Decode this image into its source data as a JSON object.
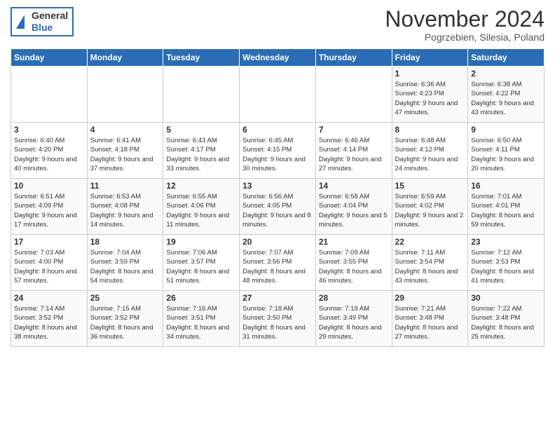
{
  "header": {
    "logo_general": "General",
    "logo_blue": "Blue",
    "month_title": "November 2024",
    "subtitle": "Pogrzebien, Silesia, Poland"
  },
  "weekdays": [
    "Sunday",
    "Monday",
    "Tuesday",
    "Wednesday",
    "Thursday",
    "Friday",
    "Saturday"
  ],
  "weeks": [
    [
      {
        "day": "",
        "info": ""
      },
      {
        "day": "",
        "info": ""
      },
      {
        "day": "",
        "info": ""
      },
      {
        "day": "",
        "info": ""
      },
      {
        "day": "",
        "info": ""
      },
      {
        "day": "1",
        "info": "Sunrise: 6:36 AM\nSunset: 4:23 PM\nDaylight: 9 hours and 47 minutes."
      },
      {
        "day": "2",
        "info": "Sunrise: 6:38 AM\nSunset: 4:22 PM\nDaylight: 9 hours and 43 minutes."
      }
    ],
    [
      {
        "day": "3",
        "info": "Sunrise: 6:40 AM\nSunset: 4:20 PM\nDaylight: 9 hours and 40 minutes."
      },
      {
        "day": "4",
        "info": "Sunrise: 6:41 AM\nSunset: 4:18 PM\nDaylight: 9 hours and 37 minutes."
      },
      {
        "day": "5",
        "info": "Sunrise: 6:43 AM\nSunset: 4:17 PM\nDaylight: 9 hours and 33 minutes."
      },
      {
        "day": "6",
        "info": "Sunrise: 6:45 AM\nSunset: 4:15 PM\nDaylight: 9 hours and 30 minutes."
      },
      {
        "day": "7",
        "info": "Sunrise: 6:46 AM\nSunset: 4:14 PM\nDaylight: 9 hours and 27 minutes."
      },
      {
        "day": "8",
        "info": "Sunrise: 6:48 AM\nSunset: 4:12 PM\nDaylight: 9 hours and 24 minutes."
      },
      {
        "day": "9",
        "info": "Sunrise: 6:50 AM\nSunset: 4:11 PM\nDaylight: 9 hours and 20 minutes."
      }
    ],
    [
      {
        "day": "10",
        "info": "Sunrise: 6:51 AM\nSunset: 4:09 PM\nDaylight: 9 hours and 17 minutes."
      },
      {
        "day": "11",
        "info": "Sunrise: 6:53 AM\nSunset: 4:08 PM\nDaylight: 9 hours and 14 minutes."
      },
      {
        "day": "12",
        "info": "Sunrise: 6:55 AM\nSunset: 4:06 PM\nDaylight: 9 hours and 11 minutes."
      },
      {
        "day": "13",
        "info": "Sunrise: 6:56 AM\nSunset: 4:05 PM\nDaylight: 9 hours and 8 minutes."
      },
      {
        "day": "14",
        "info": "Sunrise: 6:58 AM\nSunset: 4:04 PM\nDaylight: 9 hours and 5 minutes."
      },
      {
        "day": "15",
        "info": "Sunrise: 6:59 AM\nSunset: 4:02 PM\nDaylight: 9 hours and 2 minutes."
      },
      {
        "day": "16",
        "info": "Sunrise: 7:01 AM\nSunset: 4:01 PM\nDaylight: 8 hours and 59 minutes."
      }
    ],
    [
      {
        "day": "17",
        "info": "Sunrise: 7:03 AM\nSunset: 4:00 PM\nDaylight: 8 hours and 57 minutes."
      },
      {
        "day": "18",
        "info": "Sunrise: 7:04 AM\nSunset: 3:59 PM\nDaylight: 8 hours and 54 minutes."
      },
      {
        "day": "19",
        "info": "Sunrise: 7:06 AM\nSunset: 3:57 PM\nDaylight: 8 hours and 51 minutes."
      },
      {
        "day": "20",
        "info": "Sunrise: 7:07 AM\nSunset: 3:56 PM\nDaylight: 8 hours and 48 minutes."
      },
      {
        "day": "21",
        "info": "Sunrise: 7:09 AM\nSunset: 3:55 PM\nDaylight: 8 hours and 46 minutes."
      },
      {
        "day": "22",
        "info": "Sunrise: 7:11 AM\nSunset: 3:54 PM\nDaylight: 8 hours and 43 minutes."
      },
      {
        "day": "23",
        "info": "Sunrise: 7:12 AM\nSunset: 3:53 PM\nDaylight: 8 hours and 41 minutes."
      }
    ],
    [
      {
        "day": "24",
        "info": "Sunrise: 7:14 AM\nSunset: 3:52 PM\nDaylight: 8 hours and 38 minutes."
      },
      {
        "day": "25",
        "info": "Sunrise: 7:15 AM\nSunset: 3:52 PM\nDaylight: 8 hours and 36 minutes."
      },
      {
        "day": "26",
        "info": "Sunrise: 7:16 AM\nSunset: 3:51 PM\nDaylight: 8 hours and 34 minutes."
      },
      {
        "day": "27",
        "info": "Sunrise: 7:18 AM\nSunset: 3:50 PM\nDaylight: 8 hours and 31 minutes."
      },
      {
        "day": "28",
        "info": "Sunrise: 7:19 AM\nSunset: 3:49 PM\nDaylight: 8 hours and 29 minutes."
      },
      {
        "day": "29",
        "info": "Sunrise: 7:21 AM\nSunset: 3:48 PM\nDaylight: 8 hours and 27 minutes."
      },
      {
        "day": "30",
        "info": "Sunrise: 7:22 AM\nSunset: 3:48 PM\nDaylight: 8 hours and 25 minutes."
      }
    ]
  ]
}
